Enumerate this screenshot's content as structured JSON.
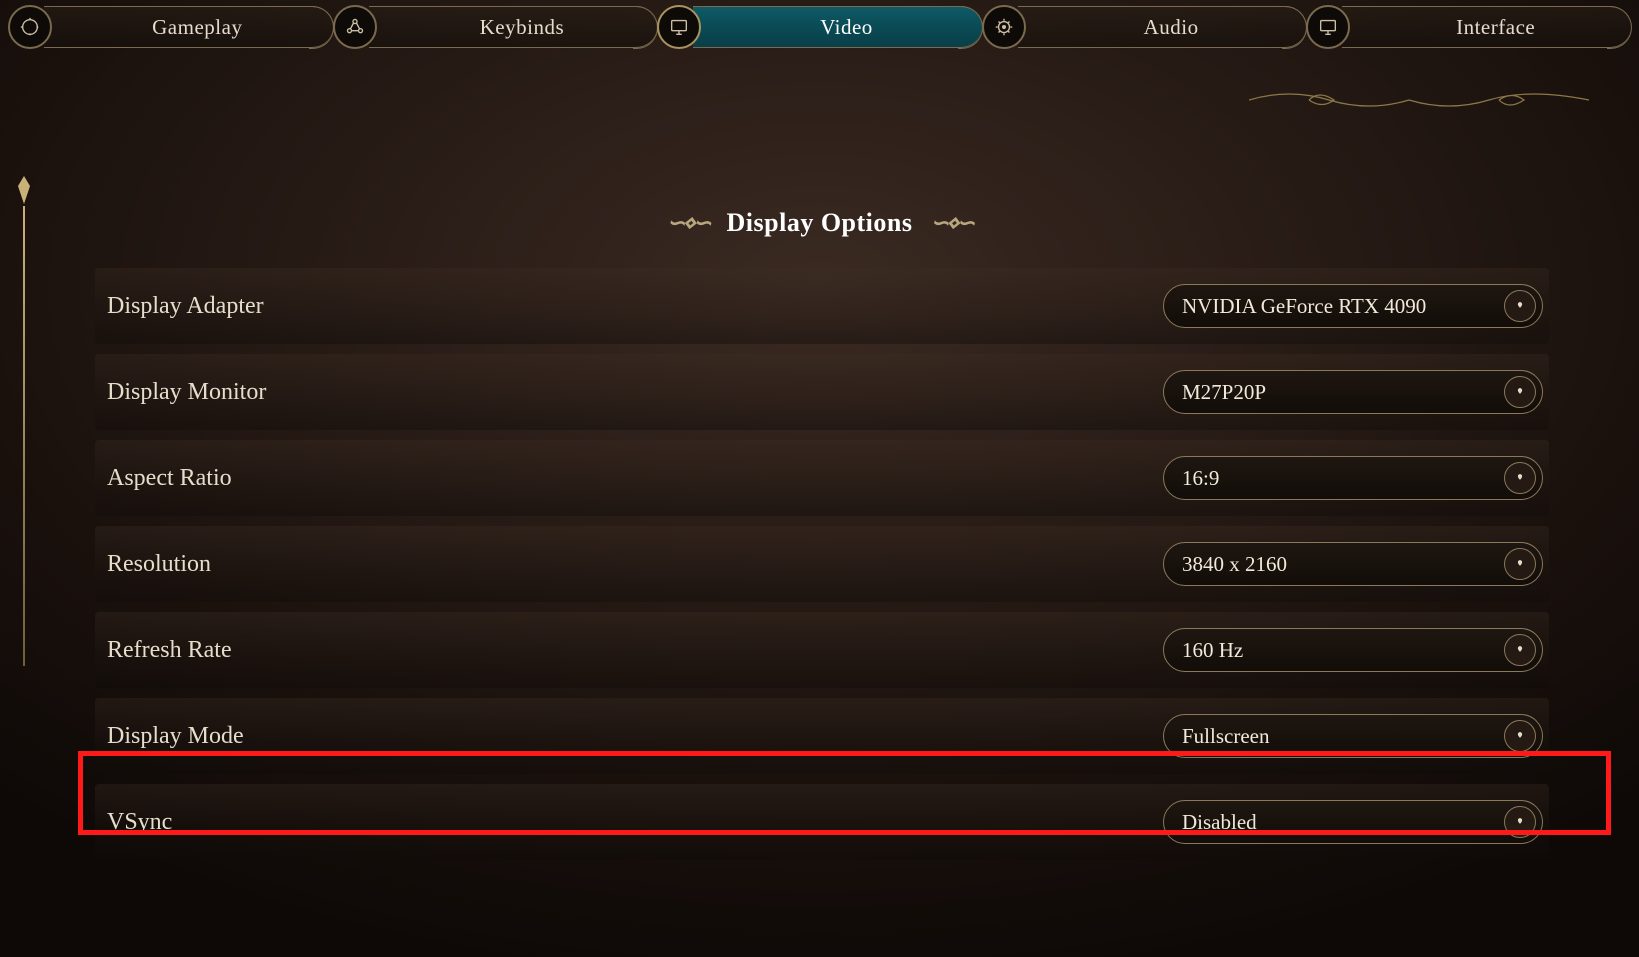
{
  "tabs": [
    {
      "label": "Gameplay",
      "icon": "target",
      "active": false
    },
    {
      "label": "Keybinds",
      "icon": "nodes",
      "active": false
    },
    {
      "label": "Video",
      "icon": "monitor",
      "active": true
    },
    {
      "label": "Audio",
      "icon": "dial",
      "active": false
    },
    {
      "label": "Interface",
      "icon": "monitor",
      "active": false
    }
  ],
  "section_title": "Display Options",
  "settings": [
    {
      "label": "Display Adapter",
      "value": "NVIDIA GeForce RTX 4090"
    },
    {
      "label": "Display Monitor",
      "value": "M27P20P"
    },
    {
      "label": "Aspect Ratio",
      "value": "16:9"
    },
    {
      "label": "Resolution",
      "value": "3840 x 2160"
    },
    {
      "label": "Refresh Rate",
      "value": "160 Hz"
    },
    {
      "label": "Display Mode",
      "value": "Fullscreen"
    },
    {
      "label": "VSync",
      "value": "Disabled",
      "highlight": true
    }
  ]
}
